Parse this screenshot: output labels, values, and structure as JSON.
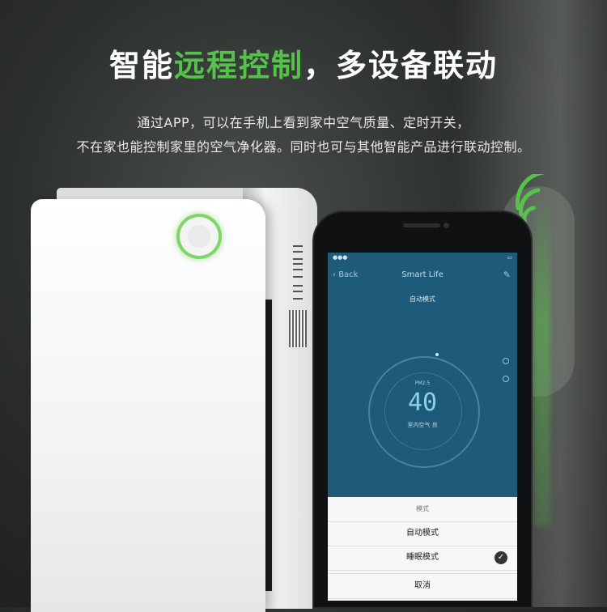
{
  "headline": {
    "part1": "智能",
    "accent": "远程控制",
    "part2": "，多设备联动",
    "accent_color": "#55c24a"
  },
  "subtitle": {
    "line1": "通过APP，可以在手机上看到家中空气质量、定时开关，",
    "line2": "不在家也能控制家里的空气净化器。同时也可与其他智能产品进行联动控制。"
  },
  "phone_app": {
    "nav_back": "Back",
    "nav_title": "Smart Life",
    "mode_title": "自动模式",
    "pm_label": "PM2.5",
    "pm_value": "40",
    "air_quality_label": "室内空气 良",
    "screen_color": "#1e5a7a",
    "mode_sheet": {
      "header": "模式",
      "options": [
        {
          "label": "自动模式",
          "selected": false
        },
        {
          "label": "睡眠模式",
          "selected": true
        }
      ],
      "cancel": "取消"
    }
  },
  "icons": {
    "power_button": "power-ring-icon",
    "wireless": "wifi-signal-icon",
    "selected": "check-circle-icon"
  }
}
